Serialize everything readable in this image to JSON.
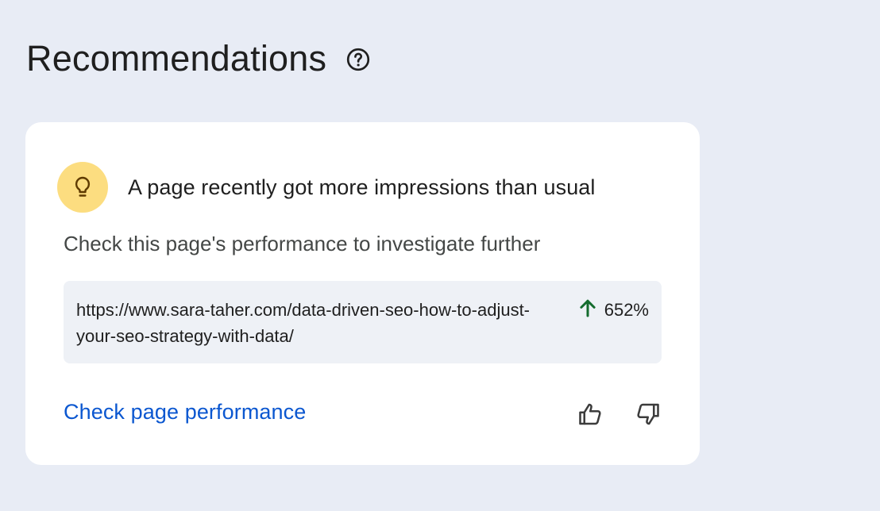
{
  "header": {
    "title": "Recommendations",
    "help_icon": "help-circle-icon"
  },
  "recommendation": {
    "icon": "lightbulb-icon",
    "icon_bg_color": "#fcdd80",
    "title": "A page recently got more impressions than usual",
    "description": "Check this page's performance to investigate further",
    "url": "https://www.sara-taher.com/data-driven-seo-how-to-adjust-your-seo-strategy-with-data/",
    "change_icon": "arrow-up-icon",
    "change_color": "#146c2e",
    "change_value": "652%",
    "action_label": "Check page performance",
    "action_color": "#0b57d0",
    "thumbs_up_icon": "thumbs-up-icon",
    "thumbs_down_icon": "thumbs-down-icon"
  }
}
